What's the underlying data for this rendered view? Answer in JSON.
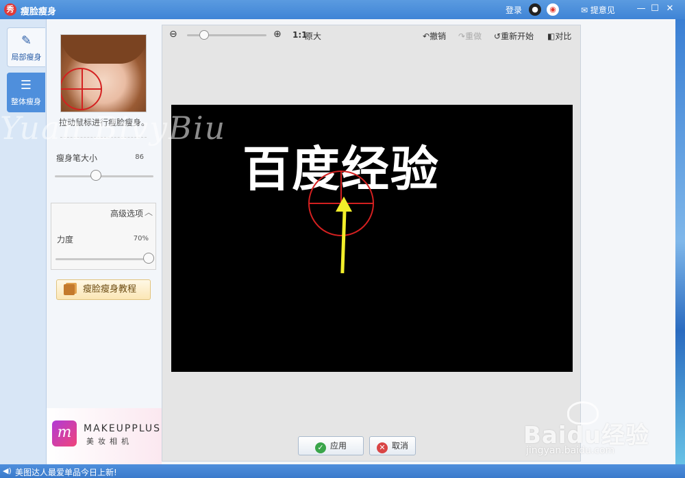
{
  "window": {
    "title": "瘦脸瘦身",
    "logo_text": "秀",
    "login_label": "登录",
    "feedback_label": "提意见",
    "minimize": "—",
    "maximize": "☐",
    "close": "✕"
  },
  "rail": {
    "tabs": [
      {
        "label": "局部瘦身",
        "icon": "brush-icon",
        "active": true
      },
      {
        "label": "整体瘦身",
        "icon": "sliders-icon",
        "active": false
      }
    ]
  },
  "panel": {
    "hint": "拉动鼠标进行瘦脸瘦身。",
    "brush_size_label": "瘦身笔大小",
    "brush_size_value": "86",
    "advanced_title": "高级选项",
    "strength_label": "力度",
    "strength_value": "70%",
    "tutorial_label": "瘦脸瘦身教程",
    "ad_logo": "m",
    "ad_name": "MAKEUPPLUS",
    "ad_sub": "美妆相机"
  },
  "toolbar": {
    "ratio_label": "1:1",
    "original_label": "原大",
    "undo_label": "撤销",
    "redo_label": "重做",
    "restart_label": "重新开始",
    "compare_label": "对比"
  },
  "photo": {
    "text": "百度经验"
  },
  "actions": {
    "apply_label": "应用",
    "cancel_label": "取消"
  },
  "status": {
    "text": "美图达人最爱单品今日上新!"
  },
  "watermarks": {
    "left": "Yuan BivyBiu",
    "baidu": "Baidu经验",
    "baidu_url": "jingyan.baidu.com"
  },
  "colors": {
    "accent": "#3f84d6",
    "marker_ring": "#d42020",
    "arrow": "#f2ee2a"
  }
}
